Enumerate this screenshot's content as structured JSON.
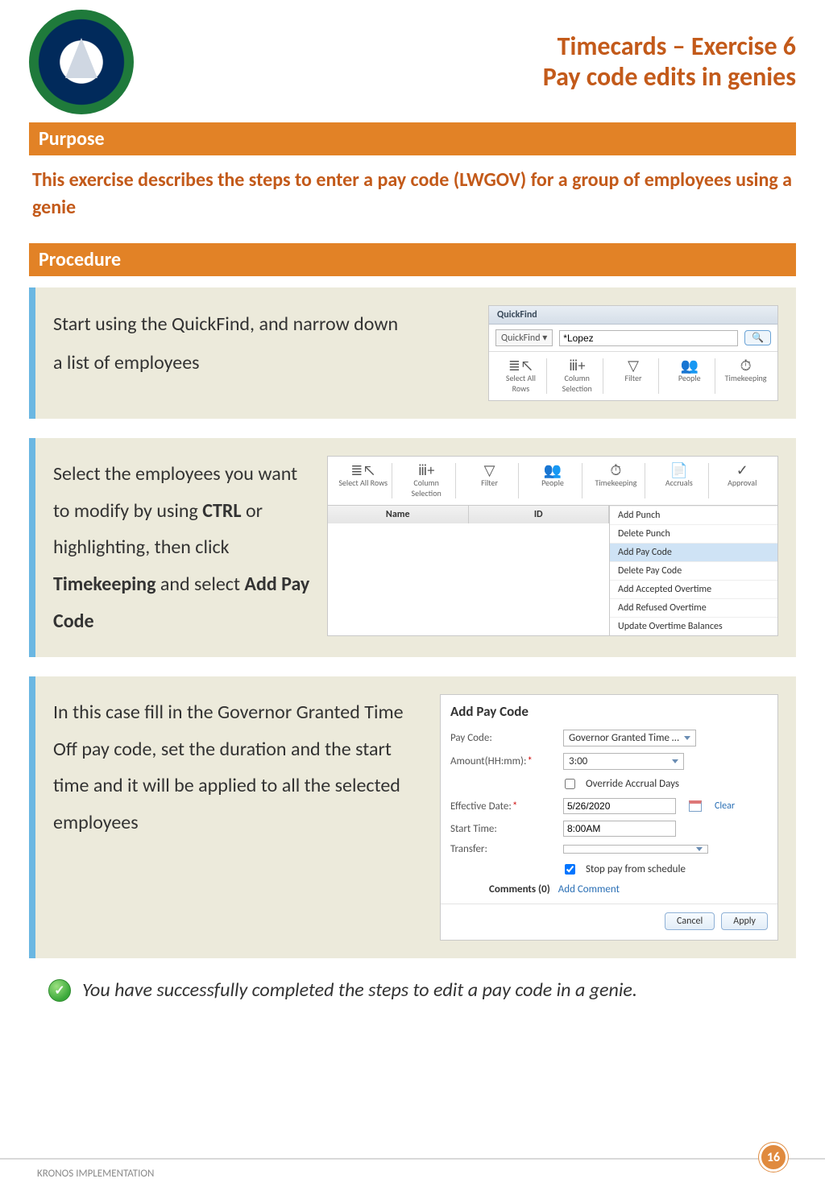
{
  "header": {
    "title1": "Timecards – Exercise 6",
    "title2": "Pay code edits in genies"
  },
  "sections": {
    "purpose": "Purpose",
    "procedure": "Procedure"
  },
  "intro": "This exercise describes the steps to enter a pay code (LWGOV) for a group of employees using a genie",
  "step1": {
    "text_a": "Start using the QuickFind, and narrow down",
    "text_b": "a list of employees",
    "shot": {
      "tab": "QuickFind",
      "dropdown": "QuickFind ▾",
      "search_value": "*Lopez",
      "tools": [
        "Select All Rows",
        "Column Selection",
        "Filter",
        "People",
        "Timekeeping"
      ]
    }
  },
  "step2": {
    "text_parts": [
      "Select the employees you want to modify by using ",
      "CTRL",
      " or highlighting,  then click ",
      "Timekeeping",
      " and select ",
      "Add Pay Code"
    ],
    "tools": [
      "Select All Rows",
      "Column Selection",
      "Filter",
      "People",
      "Timekeeping",
      "Accruals",
      "Approval"
    ],
    "table_headers": [
      "Name",
      "ID"
    ],
    "menu_items": [
      "Add Punch",
      "Delete Punch",
      "Add Pay Code",
      "Delete Pay Code",
      "Add Accepted Overtime",
      "Add Refused Overtime",
      "Update Overtime Balances"
    ],
    "highlight": "Add Pay Code"
  },
  "step3": {
    "text": "In this case fill in the Governor Granted Time Off pay code, set the duration and the start time and it will be applied to all the selected employees",
    "dialog": {
      "title": "Add Pay Code",
      "paycode_label": "Pay Code:",
      "paycode_value": "Governor Granted Time …",
      "amount_label": "Amount(HH:mm):",
      "amount_value": "3:00",
      "override_label": "Override Accrual Days",
      "effdate_label": "Effective Date:",
      "effdate_value": "5/26/2020",
      "clear": "Clear",
      "start_label": "Start Time:",
      "start_value": "8:00AM",
      "transfer_label": "Transfer:",
      "transfer_value": "",
      "stoppay_label": "Stop pay from schedule",
      "comments_label": "Comments (0)",
      "addcomment": "Add Comment",
      "cancel": "Cancel",
      "apply": "Apply"
    }
  },
  "success": "You have successfully completed the steps to edit a pay code in a genie.",
  "footer": {
    "left": "KRONOS IMPLEMENTATION",
    "page": "16"
  }
}
